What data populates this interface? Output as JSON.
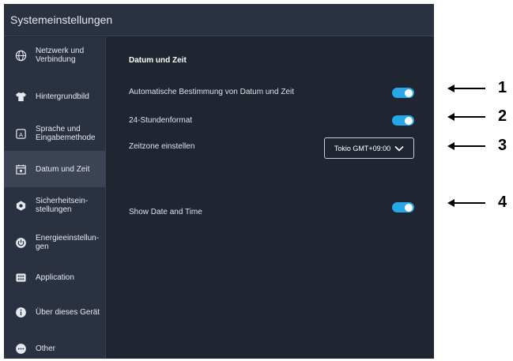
{
  "window": {
    "title": "Systemeinstellungen"
  },
  "sidebar": {
    "items": [
      {
        "label": "Netzwerk und\nVerbindung",
        "icon": "globe-icon"
      },
      {
        "label": "Hintergrundbild",
        "icon": "shirt-icon"
      },
      {
        "label": "Sprache und\nEingabemethode",
        "icon": "language-icon"
      },
      {
        "label": "Datum und Zeit",
        "icon": "calendar-icon",
        "active": true
      },
      {
        "label": "Sicherheitsein-\nstellungen",
        "icon": "shield-icon"
      },
      {
        "label": "Energieeinstellun-\ngen",
        "icon": "power-icon"
      },
      {
        "label": "Application",
        "icon": "apps-icon"
      },
      {
        "label": "Über dieses Gerät",
        "icon": "info-icon"
      },
      {
        "label": "Other",
        "icon": "more-icon"
      }
    ]
  },
  "main": {
    "section_title": "Datum und Zeit",
    "auto_time": {
      "label": "Automatische Bestimmung von Datum und Zeit",
      "enabled": true
    },
    "format_24h": {
      "label": "24-Stundenformat",
      "enabled": true
    },
    "timezone": {
      "label": "Zeitzone einstellen",
      "value": "Tokio GMT+09:00"
    },
    "show_date_time": {
      "label": "Show Date and Time",
      "enabled": true
    }
  },
  "annotations": [
    "1",
    "2",
    "3",
    "4"
  ],
  "colors": {
    "background": "#1f2531",
    "sidebar": "#2a3140",
    "accent": "#27a7e6",
    "active_item": "#3b4354"
  }
}
